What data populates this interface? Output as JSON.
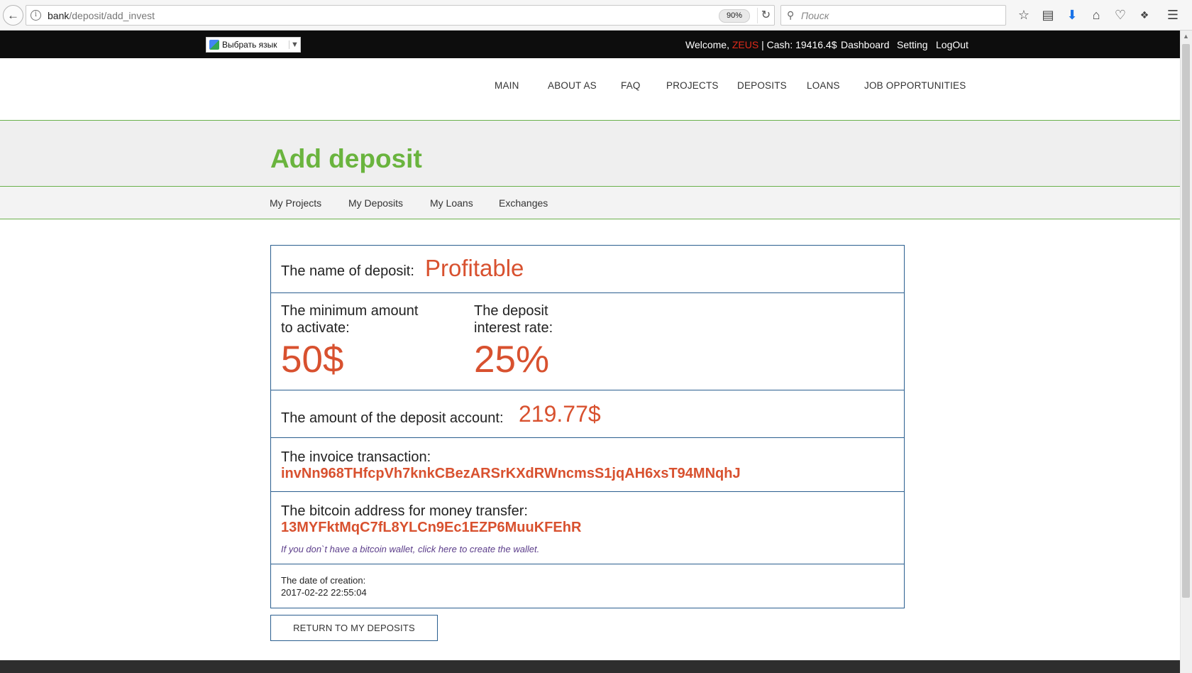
{
  "browser": {
    "url_host": "bank",
    "url_path": "/deposit/add_invest",
    "zoom": "90%",
    "search_placeholder": "Поиск"
  },
  "topbar": {
    "translate_label": "Выбрать язык",
    "welcome_prefix": "Welcome, ",
    "username": "ZEUS",
    "cash_text": " | Cash: 19416.4$",
    "links": [
      "Dashboard",
      "Setting",
      "LogOut"
    ]
  },
  "nav": {
    "items": [
      "MAIN",
      "ABOUT AS",
      "FAQ",
      "PROJECTS",
      "DEPOSITS",
      "LOANS",
      "JOB OPPORTUNITIES"
    ]
  },
  "page": {
    "title": "Add deposit",
    "subnav": [
      "My Projects",
      "My Deposits",
      "My Loans",
      "Exchanges"
    ]
  },
  "deposit": {
    "name_label": "The name of deposit:",
    "name_value": "Profitable",
    "min_label_1": "The minimum amount",
    "min_label_2": "to activate:",
    "min_value": "50$",
    "rate_label_1": "The deposit",
    "rate_label_2": "interest rate:",
    "rate_value": "25%",
    "amount_label": "The amount of the deposit account:",
    "amount_value": "219.77$",
    "invoice_label": "The invoice transaction:",
    "invoice_value": "invNn968THfcpVh7knkCBezARSrKXdRWncmsS1jqAH6xsT94MNqhJ",
    "btc_label": "The bitcoin address for money transfer:",
    "btc_value": "13MYFktMqC7fL8YLCn9Ec1EZP6MuuKFEhR",
    "wallet_link": "If you don`t have a bitcoin wallet, click here to create the wallet.",
    "date_label": "The date of creation:",
    "date_value": "2017-02-22 22:55:04"
  },
  "actions": {
    "return_label": "RETURN TO MY DEPOSITS"
  },
  "colors": {
    "accent": "#d8512f",
    "title_green": "#6ab43e",
    "border_blue": "#2a5e8f",
    "username_red": "#e02a1a"
  }
}
